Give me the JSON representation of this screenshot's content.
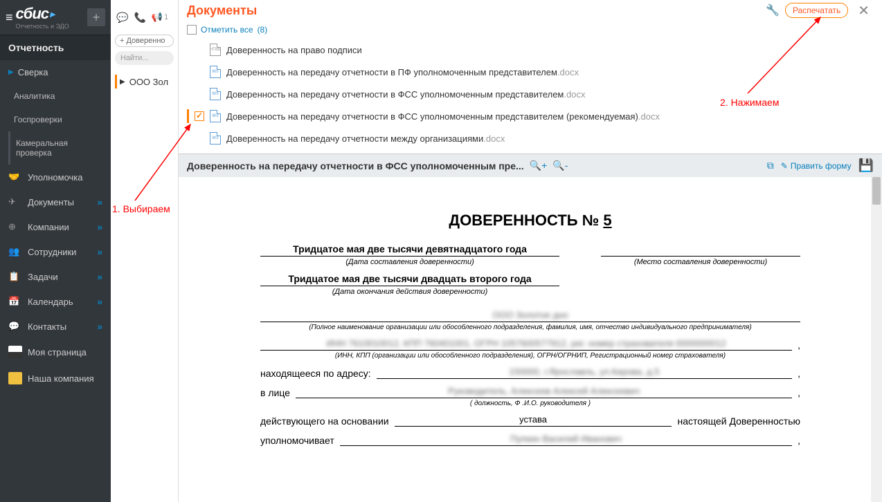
{
  "sidebar": {
    "logo": "сбис",
    "logo_sub": "Отчетность и ЭДО",
    "section": "Отчетность",
    "items": [
      {
        "label": "Сверка",
        "type": "expandable"
      },
      {
        "label": "Аналитика",
        "type": "sub"
      },
      {
        "label": "Госпроверки",
        "type": "sub"
      },
      {
        "label": "Камеральная проверка",
        "type": "sub"
      },
      {
        "label": "Уполномочка",
        "icon": "handshake"
      },
      {
        "label": "Документы",
        "icon": "send",
        "arrow": true
      },
      {
        "label": "Компании",
        "icon": "globe",
        "arrow": true
      },
      {
        "label": "Сотрудники",
        "icon": "people",
        "arrow": true
      },
      {
        "label": "Задачи",
        "icon": "clipboard",
        "arrow": true
      },
      {
        "label": "Календарь",
        "icon": "calendar",
        "arrow": true
      },
      {
        "label": "Контакты",
        "icon": "chat",
        "arrow": true
      },
      {
        "label": "Моя страница",
        "icon": "avatar"
      },
      {
        "label": "Наша компания",
        "icon": "company"
      }
    ]
  },
  "strip": {
    "badge_count": "1",
    "add_label": "+ Доверенно",
    "search_placeholder": "Найти...",
    "org": "ООО Зол"
  },
  "main": {
    "title": "Документы",
    "print_label": "Распечатать",
    "select_all": "Отметить все",
    "select_count": "(8)"
  },
  "docs": [
    {
      "name": "Доверенность на право подписи",
      "ext": "",
      "icon": "html"
    },
    {
      "name": "Доверенность на передачу отчетности в ПФ уполномоченным представителем",
      "ext": ".docx",
      "icon": "word"
    },
    {
      "name": "Доверенность на передачу отчетности в ФСС уполномоченным представителем",
      "ext": ".docx",
      "icon": "word"
    },
    {
      "name": "Доверенность на передачу отчетности в ФСС уполномоченным представителем (рекомендуемая)",
      "ext": ".docx",
      "icon": "word",
      "selected": true
    },
    {
      "name": "Доверенность на передачу отчетности между организациями",
      "ext": ".docx",
      "icon": "word"
    }
  ],
  "preview": {
    "title": "Доверенность на передачу отчетности в ФСС уполномоченным пре...",
    "edit_label": "Править форму"
  },
  "document": {
    "title": "ДОВЕРЕННОСТЬ №",
    "number": "5",
    "date_start": "Тридцатое мая две тысячи девятнадцатого года",
    "date_start_caption": "(Дата составления доверенности)",
    "place_caption": "(Место составления доверенности)",
    "date_end": "Тридцатое мая две тысячи двадцать второго года",
    "date_end_caption": "(Дата окончания действия доверенности)",
    "org_blur": "ООО Золотое дно",
    "org_caption": "(Полное наименование организации или обособленного подразделения, фамилия, имя, отчество индивидуального предпринимателя)",
    "codes_blur": "ИНН 7610010012, КПП 760401001, ОГРН 1057600577912, рег. номер страхователя 0000000012",
    "codes_caption": "(ИНН, КПП (организации или обособленного подразделения), ОГРН/ОГРНИП, Регистрационный номер страхователя)",
    "address_label": "находящееся по адресу:",
    "address_blur": "150000, г.Ярославль, ул.Кирова, д.5",
    "person_label": "в лице",
    "person_blur": "Руководитель, Алексеев Алексей Алексеевич",
    "person_caption": "( должность, Ф .И.О. руководителя )",
    "basis_label": "действующего на основании",
    "basis_value": "устава",
    "basis_suffix": "настоящей Доверенностью",
    "auth_label": "уполномочивает",
    "auth_blur": "Пупкин Василий Иванович"
  },
  "annotations": {
    "step1": "1. Выбираем",
    "step2": "2. Нажимаем"
  }
}
